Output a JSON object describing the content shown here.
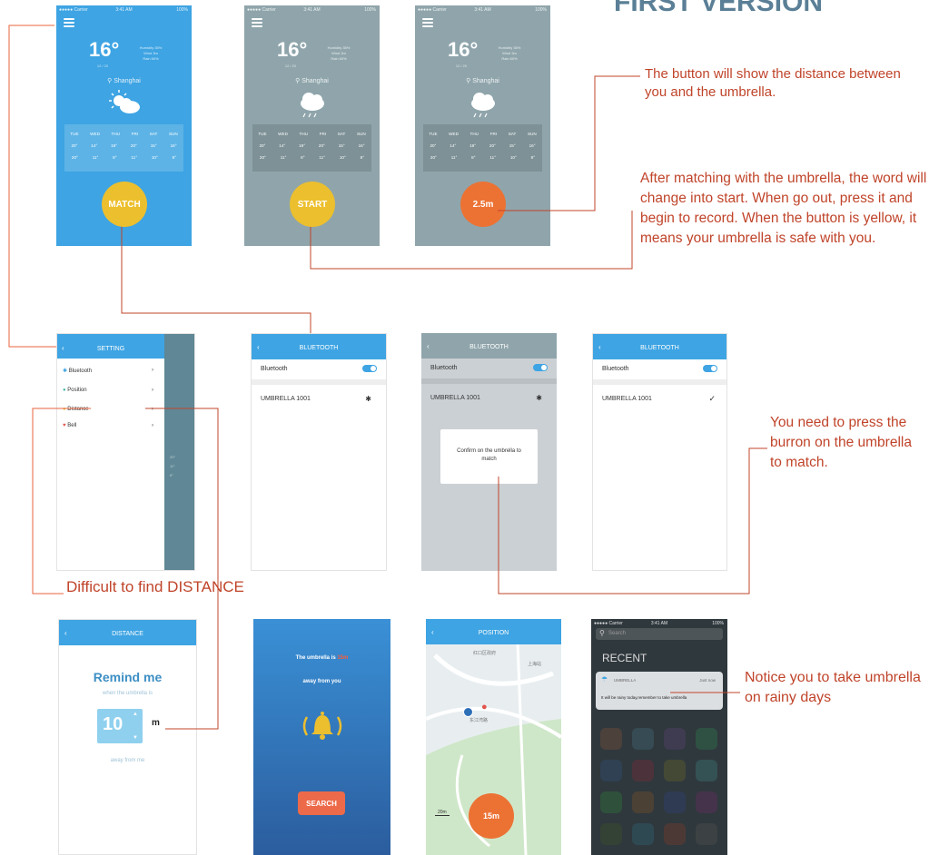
{
  "title": "FIRST VERSION",
  "weather": {
    "temp": "16°",
    "temp_sub": "12 / 20",
    "meta": [
      "Humidity 35%",
      "Wind 3m",
      "Rain 60%"
    ],
    "city": "Shanghai",
    "days": [
      "TUE",
      "WED",
      "THU",
      "FRI",
      "SAT",
      "SUN"
    ],
    "highs": [
      "20°",
      "14°",
      "19°",
      "20°",
      "15°",
      "16°"
    ],
    "lows": [
      "20°",
      "11°",
      "8°",
      "11°",
      "10°",
      "8°"
    ]
  },
  "buttons": {
    "match": "MATCH",
    "start": "START",
    "distance": "2.5m"
  },
  "annotations": {
    "distance_button": "The button will show the distance between you and the umbrella.",
    "start_button": "After matching with the umbrella, the word will change into start. When go out, press it and begin to record. When the button is yellow, it means your umbrella is safe with you.",
    "press_umbrella": "You need to press the burron on the umbrella to match.",
    "find_distance": "Difficult to find DISTANCE",
    "notice": "Notice you to take umbrella on rainy days"
  },
  "setting": {
    "title": "SETTING",
    "items": [
      {
        "icon": "bluetooth-icon",
        "label": "Bluetooth",
        "color": "#3ea4e3"
      },
      {
        "icon": "position-icon",
        "label": "Position",
        "color": "#49b8a8"
      },
      {
        "icon": "distance-icon",
        "label": "Distance",
        "color": "#e6b93a"
      },
      {
        "icon": "bell-icon",
        "label": "Bell",
        "color": "#e2544b"
      }
    ],
    "peek": [
      "20°",
      "11°",
      "8°"
    ]
  },
  "bluetooth": {
    "title": "BLUETOOTH",
    "toggle_label": "Bluetooth",
    "device": "UMBRELLA 1001",
    "confirm": "Confirm on the umbrella to match"
  },
  "distance_screen": {
    "title": "DISTANCE",
    "heading": "Remind me",
    "sub": "when the umbrella is",
    "value": "10",
    "unit": "m",
    "footer": "away from me"
  },
  "alarm": {
    "text_prefix": "The umbrella is ",
    "text_value": "15m",
    "text_suffix": "away from you",
    "search": "SEARCH"
  },
  "position": {
    "title": "POSITION",
    "scale": "20m",
    "distance": "15m",
    "labels": [
      "红口区政府",
      "上海站",
      "东江湾路"
    ]
  },
  "notification": {
    "search_placeholder": "Search",
    "recent": "RECENT",
    "app": "UMBRELLA",
    "time": "Just now",
    "message": "It will be rainy today,remember to take umbrella"
  },
  "colors": {
    "blue": "#3ea4e3",
    "grey_bg": "#8fa5ab",
    "yellow": "#ecbf2e",
    "orange": "#ec7234",
    "annotation": "#c0442a"
  }
}
